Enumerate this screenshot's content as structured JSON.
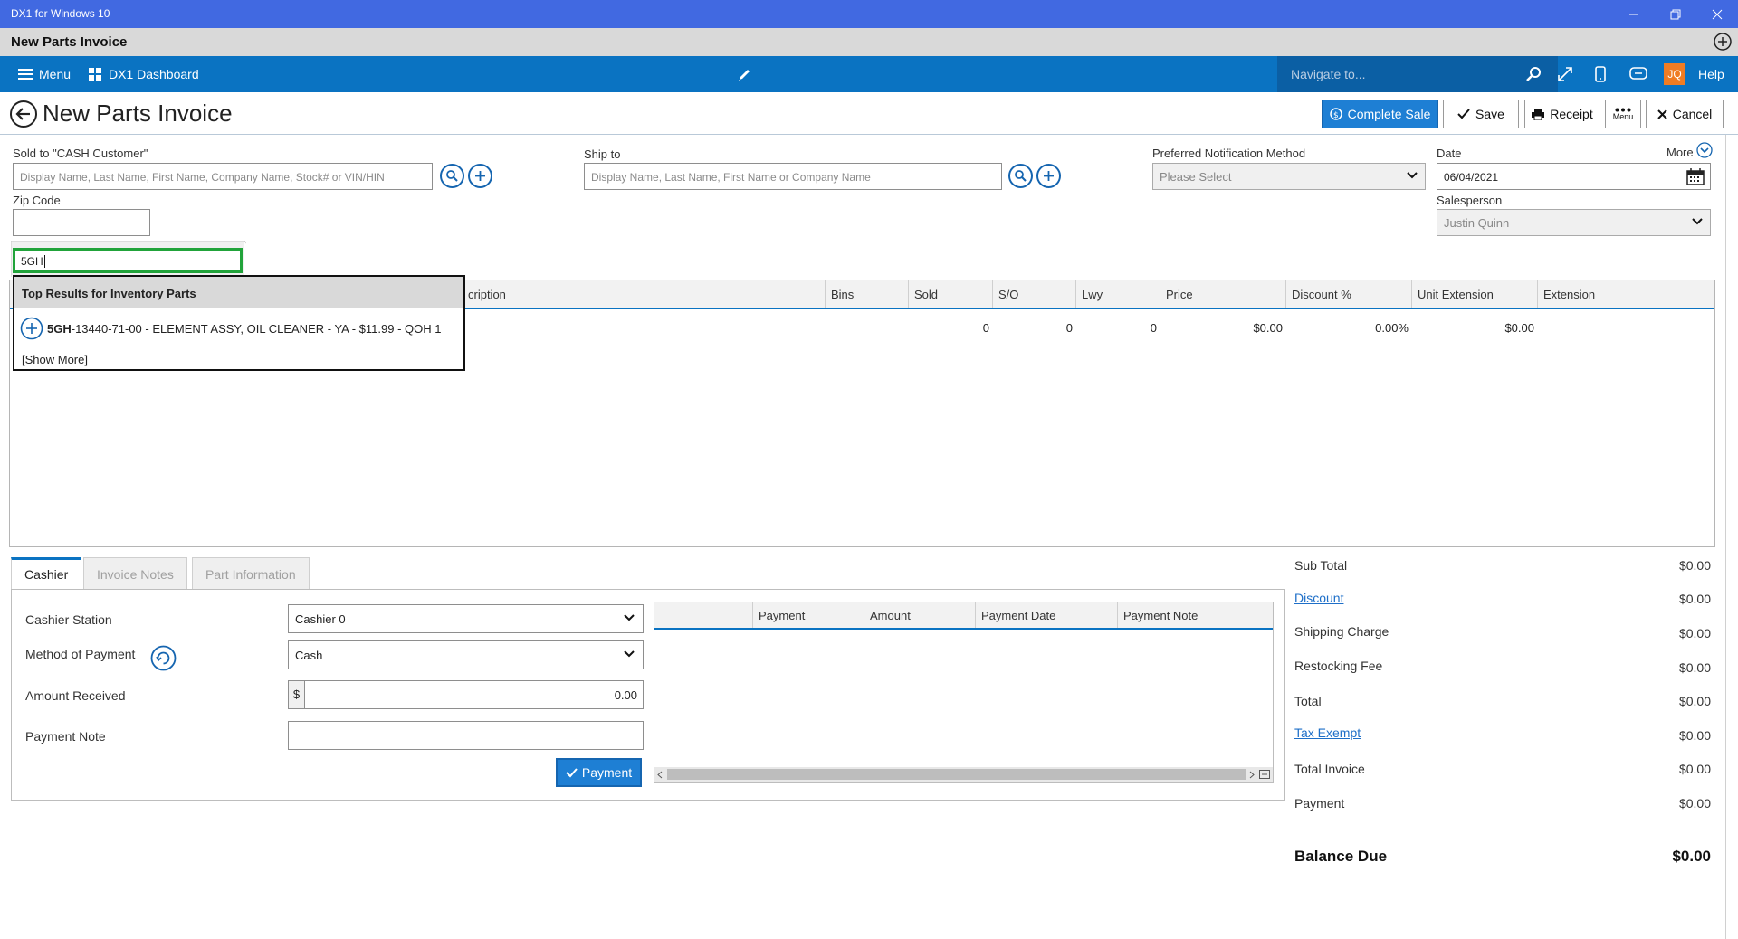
{
  "window": {
    "title": "DX1 for Windows 10"
  },
  "doc": {
    "title": "New Parts Invoice"
  },
  "nav": {
    "menu_label": "Menu",
    "dashboard_label": "DX1 Dashboard",
    "search_placeholder": "Navigate to...",
    "user_initials": "JQ",
    "help_label": "Help",
    "accent": "#0a73c2",
    "icons": [
      "hamburger-icon",
      "grid-icon",
      "pencil-icon",
      "search-icon",
      "expand-icon",
      "phone-icon",
      "chat-icon"
    ]
  },
  "page": {
    "title": "New Parts Invoice",
    "buttons": {
      "complete_sale": "Complete Sale",
      "save": "Save",
      "receipt": "Receipt",
      "menu": "Menu",
      "cancel": "Cancel"
    }
  },
  "form": {
    "sold_to_label": "Sold to  \"CASH Customer\"",
    "sold_to_placeholder": "Display Name, Last Name, First Name, Company Name, Stock# or VIN/HIN",
    "zip_label": "Zip Code",
    "zip_value": "",
    "ship_to_label": "Ship to",
    "ship_to_placeholder": "Display Name, Last Name, First Name or Company Name",
    "notification_label": "Preferred Notification Method",
    "notification_value": "Please Select",
    "date_label": "Date",
    "date_value": "06/04/2021",
    "more_label": "More",
    "salesperson_label": "Salesperson",
    "salesperson_value": "Justin Quinn"
  },
  "part_search": {
    "value": "5GH",
    "results_header": "Top Results for Inventory Parts",
    "result_match": "5GH",
    "result_rest": "-13440-71-00 - ELEMENT ASSY, OIL CLEANER - YA - $11.99 - QOH 1",
    "show_more": "[Show More]"
  },
  "grid": {
    "columns": [
      "cription",
      "Bins",
      "Sold",
      "S/O",
      "Lwy",
      "Price",
      "Discount %",
      "Unit Extension",
      "Extension"
    ],
    "row": {
      "sold": "0",
      "so": "0",
      "lwy": "0",
      "price": "$0.00",
      "discount": "0.00%",
      "unit_extension": "$0.00"
    }
  },
  "tabs": [
    "Cashier",
    "Invoice Notes",
    "Part Information"
  ],
  "cashier": {
    "station_label": "Cashier Station",
    "station_value": "Cashier 0",
    "method_label": "Method of Payment",
    "method_value": "Cash",
    "amount_label": "Amount Received",
    "currency": "$",
    "amount_value": "0.00",
    "note_label": "Payment Note",
    "note_value": "",
    "payment_button": "Payment"
  },
  "payments": {
    "columns": [
      "Payment",
      "Amount",
      "Payment Date",
      "Payment Note"
    ]
  },
  "totals": {
    "sub_total_label": "Sub Total",
    "sub_total": "$0.00",
    "discount_label": "Discount",
    "discount": "$0.00",
    "shipping_label": "Shipping Charge",
    "shipping": "$0.00",
    "restocking_label": "Restocking Fee",
    "restocking": "$0.00",
    "total_label": "Total",
    "total": "$0.00",
    "tax_exempt_label": "Tax Exempt",
    "tax_exempt": "$0.00",
    "total_invoice_label": "Total Invoice",
    "total_invoice": "$0.00",
    "payment_label": "Payment",
    "payment": "$0.00",
    "balance_due_label": "Balance Due",
    "balance_due": "$0.00"
  }
}
